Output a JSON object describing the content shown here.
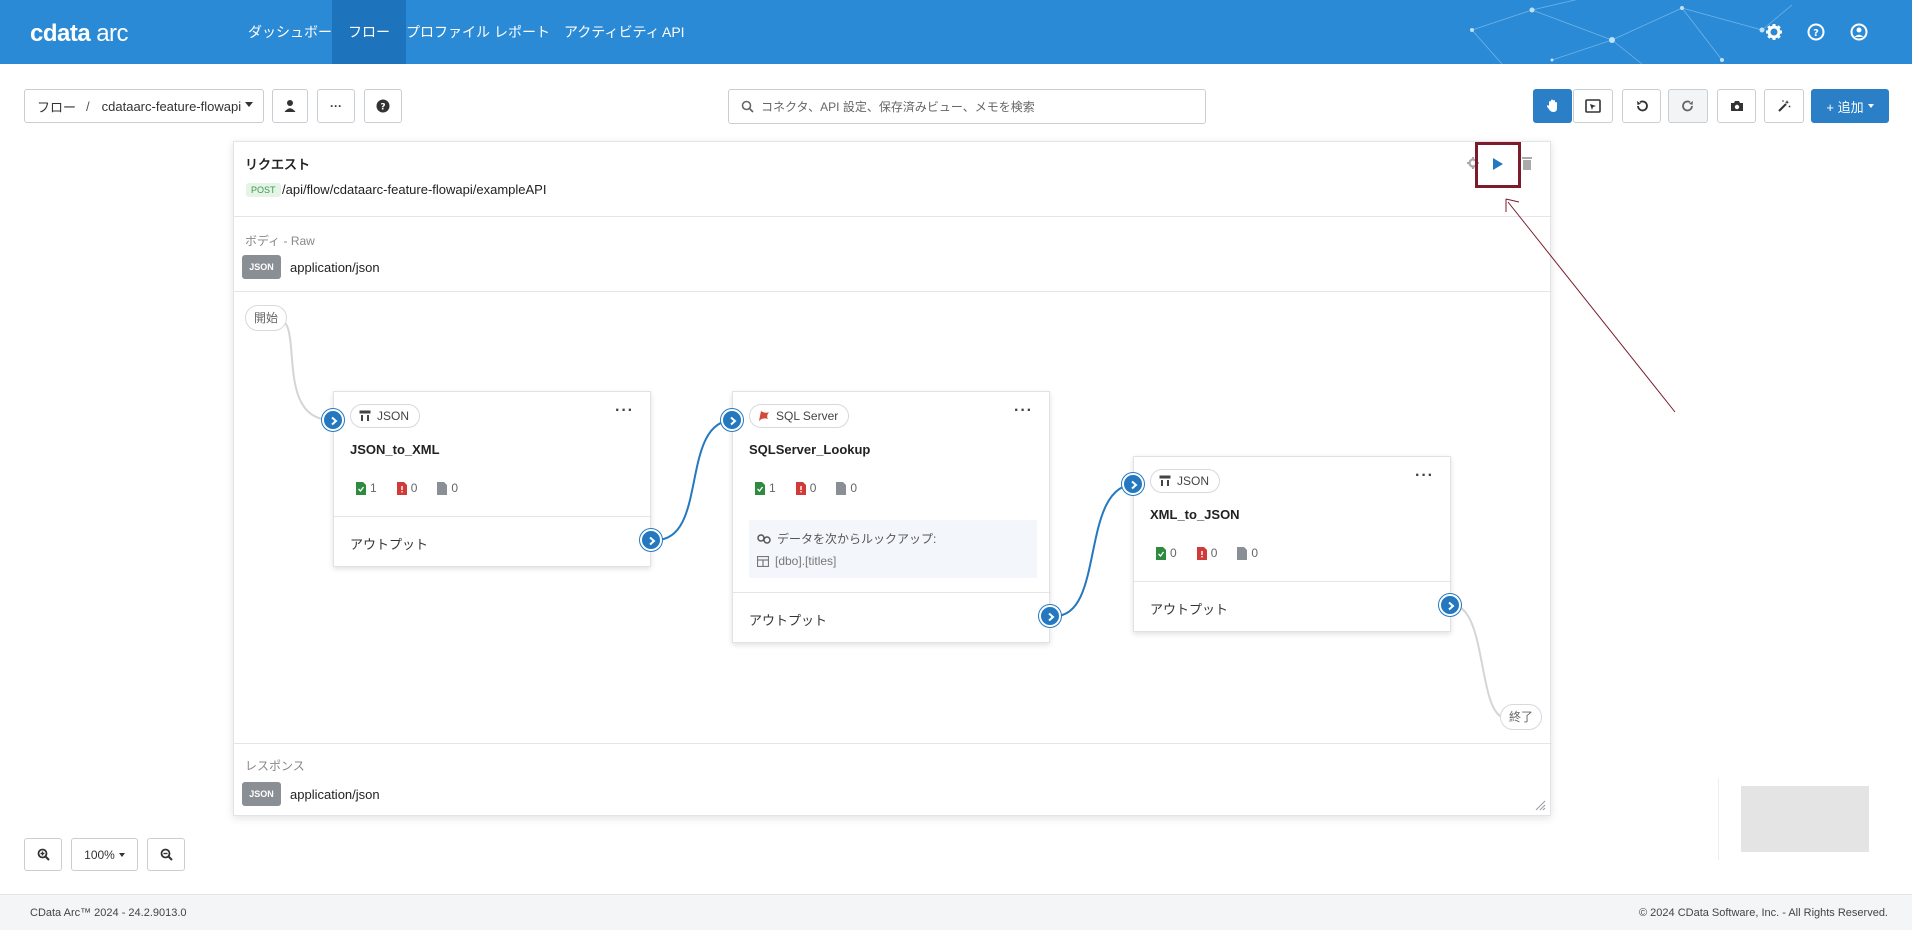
{
  "app": {
    "logo_main": "cdata",
    "logo_sub": "arc"
  },
  "nav": {
    "items": [
      {
        "label": "ダッシュボード"
      },
      {
        "label": "フロー"
      },
      {
        "label": "プロファイル"
      },
      {
        "label": "レポート"
      },
      {
        "label": "アクティビティ"
      },
      {
        "label": "API"
      }
    ],
    "active": "フロー"
  },
  "toolbar": {
    "breadcrumb_root": "フロー",
    "breadcrumb_sep": "/",
    "breadcrumb_flow": "cdataarc-feature-flowapi",
    "more_label": "···",
    "search_placeholder": "コネクタ、API 設定、保存済みビュー、メモを検索",
    "add_label": "+ 追加"
  },
  "request": {
    "title": "リクエスト",
    "method": "POST",
    "path": "/api/flow/cdataarc-feature-flowapi/exampleAPI",
    "body_label": "ボディ - Raw",
    "body_badge": "JSON",
    "body_content_type": "application/json"
  },
  "flow": {
    "start_label": "開始",
    "end_label": "終了",
    "nodes": [
      {
        "type": "JSON",
        "name": "JSON_to_XML",
        "success": "1",
        "error": "0",
        "pending": "0",
        "output": "アウトプット"
      },
      {
        "type": "SQL Server",
        "name": "SQLServer_Lookup",
        "success": "1",
        "error": "0",
        "pending": "0",
        "lookup_label": "データを次からルックアップ:",
        "lookup_table": "[dbo].[titles]",
        "output": "アウトプット"
      },
      {
        "type": "JSON",
        "name": "XML_to_JSON",
        "success": "0",
        "error": "0",
        "pending": "0",
        "output": "アウトプット"
      }
    ]
  },
  "response": {
    "label": "レスポンス",
    "badge": "JSON",
    "content_type": "application/json"
  },
  "zoom": {
    "level": "100%"
  },
  "footer": {
    "version": "CData Arc™ 2024 - 24.2.9013.0",
    "copyright": "© 2024 CData Software, Inc. - All Rights Reserved."
  },
  "colors": {
    "brand": "#2b8ad6",
    "nav_active": "#1d74bd",
    "port": "#2378bf",
    "highlight": "#7b1b2b"
  }
}
